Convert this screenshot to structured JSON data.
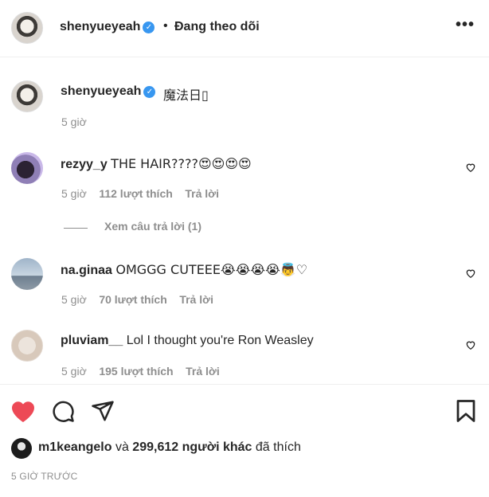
{
  "header": {
    "username": "shenyueyeah",
    "separator": "•",
    "follow_status": "Đang theo dõi",
    "more_icon": "more-horizontal-icon"
  },
  "caption": {
    "username": "shenyueyeah",
    "text": "魔法日▯",
    "time": "5 giờ"
  },
  "comments": [
    {
      "username": "rezyy_y",
      "text": "THE HAIR????😍😍😍😍",
      "time": "5 giờ",
      "likes": "112 lượt thích",
      "reply": "Trả lời"
    },
    {
      "username": "na.ginaa",
      "text": "OMGGG CUTEEE😭😭😭😭👼♡",
      "time": "5 giờ",
      "likes": "70 lượt thích",
      "reply": "Trả lời"
    },
    {
      "username": "pluviam__",
      "text": "Lol I thought you're Ron Weasley",
      "time": "5 giờ",
      "likes": "195 lượt thích",
      "reply": "Trả lời"
    }
  ],
  "view_replies": "Xem câu trả lời (1)",
  "actions": {
    "like_icon": "heart-filled-icon",
    "comment_icon": "comment-icon",
    "share_icon": "send-icon",
    "save_icon": "bookmark-icon",
    "like_color": "#ed4956"
  },
  "likes": {
    "user": "m1keangelo",
    "connector": "và",
    "count": "299,612 người khác",
    "suffix": "đã thích"
  },
  "post_time": "5 GIỜ TRƯỚC"
}
